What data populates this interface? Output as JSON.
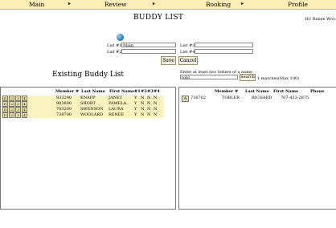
{
  "menu": {
    "items": [
      "Main",
      "Review",
      "Booking",
      "Profile"
    ],
    "arrow": "▸"
  },
  "page_title": "BUDDY LIST",
  "greeting": "Hi! Renee Woo",
  "icon": "globe-icon",
  "lists": {
    "list1_label": "List #1",
    "list1_value": "Main",
    "list2_label": "List #2",
    "list2_value": "",
    "list3_label": "List #3",
    "list3_value": "",
    "list4_label": "List #4",
    "list4_value": ""
  },
  "buttons": {
    "save": "Save",
    "cancel": "Cancel"
  },
  "existing_title": "Existing Buddy List",
  "search": {
    "hint": "Enter at least two letters of a name",
    "query": "tobl",
    "button": "Search",
    "result_text": "1 matches(Max 100)"
  },
  "left_table": {
    "headers": [
      "Member #",
      "Last Name",
      "First Name",
      "#1",
      "#2",
      "#3",
      "#4"
    ],
    "rows": [
      {
        "actions": [
          "D",
          "2",
          "3",
          "4"
        ],
        "member": "833200",
        "last": "KNAPP",
        "first": "JANET",
        "f1": "Y",
        "f2": "N",
        "f3": "N",
        "f4": "N"
      },
      {
        "actions": [
          "D",
          "2",
          "3",
          "4"
        ],
        "member": "903800",
        "last": "SHORT",
        "first": "PAMELA",
        "f1": "Y",
        "f2": "N",
        "f3": "N",
        "f4": "N"
      },
      {
        "actions": [
          "D",
          "2",
          "3",
          "4"
        ],
        "member": "703200",
        "last": "SWENSON",
        "first": "LAURA",
        "f1": "Y",
        "f2": "N",
        "f3": "N",
        "f4": "N"
      },
      {
        "actions": [
          "D",
          "2",
          "3",
          "4"
        ],
        "member": "738700",
        "last": "WOOLARD",
        "first": "RENEE",
        "f1": "Y",
        "f2": "N",
        "f3": "N",
        "f4": "N"
      }
    ]
  },
  "right_table": {
    "headers": [
      "Member #",
      "Last Name",
      "First Name",
      "Phone"
    ],
    "rows": [
      {
        "action": "A",
        "member": "738702",
        "last": "TOBLER",
        "first": "RICHARD",
        "phone": "707-433-2875"
      }
    ]
  },
  "colors": {
    "menubar": "#fdeeb8",
    "row_highlight": "#fbf3bf",
    "button_bg": "#f1ede0"
  }
}
